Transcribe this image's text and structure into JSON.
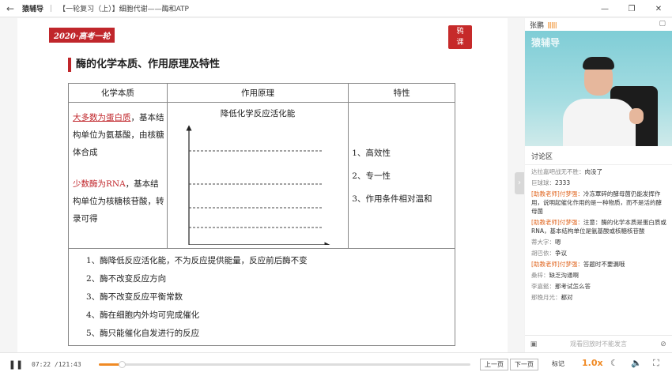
{
  "titlebar": {
    "back_icon": "back-arrow-icon",
    "app_name": "猿辅导",
    "separator": "|",
    "course_title": "【一轮复习（上）】细胞代谢——酶和ATP",
    "controls": [
      "minimize-icon",
      "restore-icon",
      "close-icon"
    ]
  },
  "slide": {
    "badge": "2020·高考一轮",
    "logo_text": "鸦\n课",
    "heading": "酶的化学本质、作用原理及特性",
    "table": {
      "headers": [
        "化学本质",
        "作用原理",
        "特性"
      ],
      "nature": {
        "line1_red": "大多数为蛋白质",
        "line1_rest": "，基本结构单位为氨基酸，由核糖体合成",
        "line2_red": "少数酶为RNA",
        "line2_rest": "，基本结构单位为核糖核苷酸，转录可得"
      },
      "principle_title": "降低化学反应活化能",
      "traits": [
        "1、高效性",
        "2、专一性",
        "3、作用条件相对温和"
      ],
      "notes": [
        "1、酶降低反应活化能，不为反应提供能量，反应前后酶不变",
        "2、酶不改变反应方向",
        "3、酶不改变反应平衡常数",
        "4、酶在细胞内外均可完成催化",
        "5、酶只能催化自发进行的反应"
      ]
    }
  },
  "side": {
    "teacher_name": "张鹏",
    "signal": "|||||||",
    "watermark": "猿辅导",
    "discussion_title": "讨论区",
    "messages": [
      {
        "nick": "达拉嘉吧战无不胜：",
        "text": "肉没了",
        "teacher": false
      },
      {
        "nick": "巨球球：",
        "text": "2333",
        "teacher": false
      },
      {
        "nick": "[助教老师]付梦强：",
        "text": "冷冻覃碎的酵母菌仍能发挥作用，说明起催化作用的是一种物质，而不是活的酵母菌",
        "teacher": true
      },
      {
        "nick": "[助教老师]付梦强：",
        "text": "注意：酶的化学本质是蛋白质或RNA，基本结构单位是氨基酸或核糖核苷酸",
        "teacher": true
      },
      {
        "nick": "蒂大字：",
        "text": "嗯",
        "teacher": false
      },
      {
        "nick": "胡巴依：",
        "text": "争议",
        "teacher": false
      },
      {
        "nick": "[助教老师]付梦强：",
        "text": "答题时不要漏哦",
        "teacher": true
      },
      {
        "nick": "桑梓：",
        "text": "缺乏沟通啊",
        "teacher": false
      },
      {
        "nick": "李嘉懿：",
        "text": "那考试怎么答",
        "teacher": false
      },
      {
        "nick": "那晚月光：",
        "text": "都对",
        "teacher": false
      }
    ],
    "input_placeholder": "观看回放时不能发言"
  },
  "player": {
    "current_time": "07:22",
    "total_time": "/121:43",
    "progress": 0.061,
    "prev_label": "上一页",
    "next_label": "下一页",
    "mark_label": "标记",
    "speed": "1.0x"
  }
}
